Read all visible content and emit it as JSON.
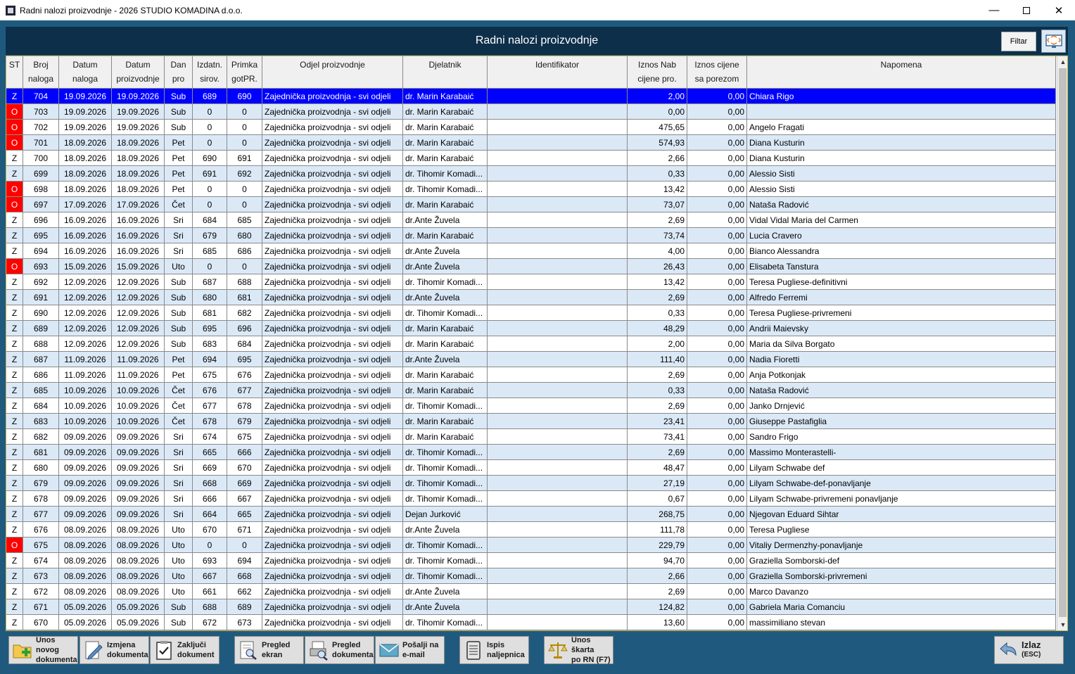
{
  "window": {
    "title": "Radni nalozi proizvodnje - 2026 STUDIO KOMADINA d.o.o.",
    "minimize": "—",
    "close": "✕"
  },
  "header": {
    "title": "Radni nalozi proizvodnje",
    "filter_label": "Filtar"
  },
  "columns": [
    {
      "key": "st",
      "label": "ST"
    },
    {
      "key": "broj",
      "label": "Broj\nnaloga"
    },
    {
      "key": "datum_naloga",
      "label": "Datum\nnaloga"
    },
    {
      "key": "datum_proizvodnje",
      "label": "Datum\nproizvodnje"
    },
    {
      "key": "dan",
      "label": "Dan\npro"
    },
    {
      "key": "izdatn",
      "label": "Izdatn.\nsirov."
    },
    {
      "key": "primka",
      "label": "Primka\ngotPR."
    },
    {
      "key": "odjel",
      "label": "Odjel proizvodnje"
    },
    {
      "key": "djelatnik",
      "label": "Djelatnik"
    },
    {
      "key": "identifikator",
      "label": "Identifikator"
    },
    {
      "key": "iznos_nab",
      "label": "Iznos Nab\ncijene pro."
    },
    {
      "key": "iznos_cijene",
      "label": "Iznos cijene\nsa porezom"
    },
    {
      "key": "napomena",
      "label": "Napomena"
    }
  ],
  "rows": [
    [
      "Z",
      "704",
      "19.09.2026",
      "19.09.2026",
      "Sub",
      "689",
      "690",
      "Zajednička proizvodnja - svi odjeli",
      "dr. Marin Karabaić",
      "",
      "2,00",
      "0,00",
      "Chiara Rigo"
    ],
    [
      "O",
      "703",
      "19.09.2026",
      "19.09.2026",
      "Sub",
      "0",
      "0",
      "Zajednička proizvodnja - svi odjeli",
      "dr. Marin Karabaić",
      "",
      "0,00",
      "0,00",
      ""
    ],
    [
      "O",
      "702",
      "19.09.2026",
      "19.09.2026",
      "Sub",
      "0",
      "0",
      "Zajednička proizvodnja - svi odjeli",
      "dr. Marin Karabaić",
      "",
      "475,65",
      "0,00",
      "Angelo Fragati"
    ],
    [
      "O",
      "701",
      "18.09.2026",
      "18.09.2026",
      "Pet",
      "0",
      "0",
      "Zajednička proizvodnja - svi odjeli",
      "dr. Marin Karabaić",
      "",
      "574,93",
      "0,00",
      "Diana Kusturin"
    ],
    [
      "Z",
      "700",
      "18.09.2026",
      "18.09.2026",
      "Pet",
      "690",
      "691",
      "Zajednička proizvodnja - svi odjeli",
      "dr. Marin Karabaić",
      "",
      "2,66",
      "0,00",
      "Diana Kusturin"
    ],
    [
      "Z",
      "699",
      "18.09.2026",
      "18.09.2026",
      "Pet",
      "691",
      "692",
      "Zajednička proizvodnja - svi odjeli",
      "dr. Tihomir Komadi...",
      "",
      "0,33",
      "0,00",
      "Alessio Sisti"
    ],
    [
      "O",
      "698",
      "18.09.2026",
      "18.09.2026",
      "Pet",
      "0",
      "0",
      "Zajednička proizvodnja - svi odjeli",
      "dr. Tihomir Komadi...",
      "",
      "13,42",
      "0,00",
      "Alessio Sisti"
    ],
    [
      "O",
      "697",
      "17.09.2026",
      "17.09.2026",
      "Čet",
      "0",
      "0",
      "Zajednička proizvodnja - svi odjeli",
      "dr. Marin Karabaić",
      "",
      "73,07",
      "0,00",
      "Nataša Radović"
    ],
    [
      "Z",
      "696",
      "16.09.2026",
      "16.09.2026",
      "Sri",
      "684",
      "685",
      "Zajednička proizvodnja - svi odjeli",
      "dr.Ante Žuvela",
      "",
      "2,69",
      "0,00",
      "Vidal Vidal Maria del Carmen"
    ],
    [
      "Z",
      "695",
      "16.09.2026",
      "16.09.2026",
      "Sri",
      "679",
      "680",
      "Zajednička proizvodnja - svi odjeli",
      "dr. Marin Karabaić",
      "",
      "73,74",
      "0,00",
      "Lucia Cravero"
    ],
    [
      "Z",
      "694",
      "16.09.2026",
      "16.09.2026",
      "Sri",
      "685",
      "686",
      "Zajednička proizvodnja - svi odjeli",
      "dr.Ante Žuvela",
      "",
      "4,00",
      "0,00",
      "Bianco Alessandra"
    ],
    [
      "O",
      "693",
      "15.09.2026",
      "15.09.2026",
      "Uto",
      "0",
      "0",
      "Zajednička proizvodnja - svi odjeli",
      "dr.Ante Žuvela",
      "",
      "26,43",
      "0,00",
      "Elisabeta Tanstura"
    ],
    [
      "Z",
      "692",
      "12.09.2026",
      "12.09.2026",
      "Sub",
      "687",
      "688",
      "Zajednička proizvodnja - svi odjeli",
      "dr. Tihomir Komadi...",
      "",
      "13,42",
      "0,00",
      "Teresa Pugliese-definitivni"
    ],
    [
      "Z",
      "691",
      "12.09.2026",
      "12.09.2026",
      "Sub",
      "680",
      "681",
      "Zajednička proizvodnja - svi odjeli",
      "dr.Ante Žuvela",
      "",
      "2,69",
      "0,00",
      "Alfredo Ferremi"
    ],
    [
      "Z",
      "690",
      "12.09.2026",
      "12.09.2026",
      "Sub",
      "681",
      "682",
      "Zajednička proizvodnja - svi odjeli",
      "dr. Tihomir Komadi...",
      "",
      "0,33",
      "0,00",
      "Teresa Pugliese-privremeni"
    ],
    [
      "Z",
      "689",
      "12.09.2026",
      "12.09.2026",
      "Sub",
      "695",
      "696",
      "Zajednička proizvodnja - svi odjeli",
      "dr. Marin Karabaić",
      "",
      "48,29",
      "0,00",
      "Andrii Maievsky"
    ],
    [
      "Z",
      "688",
      "12.09.2026",
      "12.09.2026",
      "Sub",
      "683",
      "684",
      "Zajednička proizvodnja - svi odjeli",
      "dr. Marin Karabaić",
      "",
      "2,00",
      "0,00",
      "Maria da Silva Borgato"
    ],
    [
      "Z",
      "687",
      "11.09.2026",
      "11.09.2026",
      "Pet",
      "694",
      "695",
      "Zajednička proizvodnja - svi odjeli",
      "dr.Ante Žuvela",
      "",
      "111,40",
      "0,00",
      "Nadia Fioretti"
    ],
    [
      "Z",
      "686",
      "11.09.2026",
      "11.09.2026",
      "Pet",
      "675",
      "676",
      "Zajednička proizvodnja - svi odjeli",
      "dr. Marin Karabaić",
      "",
      "2,69",
      "0,00",
      "Anja Potkonjak"
    ],
    [
      "Z",
      "685",
      "10.09.2026",
      "10.09.2026",
      "Čet",
      "676",
      "677",
      "Zajednička proizvodnja - svi odjeli",
      "dr. Marin Karabaić",
      "",
      "0,33",
      "0,00",
      "Nataša Radović"
    ],
    [
      "Z",
      "684",
      "10.09.2026",
      "10.09.2026",
      "Čet",
      "677",
      "678",
      "Zajednička proizvodnja - svi odjeli",
      "dr. Tihomir Komadi...",
      "",
      "2,69",
      "0,00",
      "Janko Drnjević"
    ],
    [
      "Z",
      "683",
      "10.09.2026",
      "10.09.2026",
      "Čet",
      "678",
      "679",
      "Zajednička proizvodnja - svi odjeli",
      "dr. Marin Karabaić",
      "",
      "23,41",
      "0,00",
      "Giuseppe Pastafiglia"
    ],
    [
      "Z",
      "682",
      "09.09.2026",
      "09.09.2026",
      "Sri",
      "674",
      "675",
      "Zajednička proizvodnja - svi odjeli",
      "dr. Marin Karabaić",
      "",
      "73,41",
      "0,00",
      "Sandro Frigo"
    ],
    [
      "Z",
      "681",
      "09.09.2026",
      "09.09.2026",
      "Sri",
      "665",
      "666",
      "Zajednička proizvodnja - svi odjeli",
      "dr. Tihomir Komadi...",
      "",
      "2,69",
      "0,00",
      "Massimo Monterastelli-"
    ],
    [
      "Z",
      "680",
      "09.09.2026",
      "09.09.2026",
      "Sri",
      "669",
      "670",
      "Zajednička proizvodnja - svi odjeli",
      "dr. Tihomir Komadi...",
      "",
      "48,47",
      "0,00",
      "Lilyam Schwabe def"
    ],
    [
      "Z",
      "679",
      "09.09.2026",
      "09.09.2026",
      "Sri",
      "668",
      "669",
      "Zajednička proizvodnja - svi odjeli",
      "dr. Tihomir Komadi...",
      "",
      "27,19",
      "0,00",
      "Lilyam Schwabe-def-ponavljanje"
    ],
    [
      "Z",
      "678",
      "09.09.2026",
      "09.09.2026",
      "Sri",
      "666",
      "667",
      "Zajednička proizvodnja - svi odjeli",
      "dr. Tihomir Komadi...",
      "",
      "0,67",
      "0,00",
      "Lilyam Schwabe-privremeni ponavljanje"
    ],
    [
      "Z",
      "677",
      "09.09.2026",
      "09.09.2026",
      "Sri",
      "664",
      "665",
      "Zajednička proizvodnja - svi odjeli",
      "Dejan Jurković",
      "",
      "268,75",
      "0,00",
      "Njegovan Eduard Sihtar"
    ],
    [
      "Z",
      "676",
      "08.09.2026",
      "08.09.2026",
      "Uto",
      "670",
      "671",
      "Zajednička proizvodnja - svi odjeli",
      "dr.Ante Žuvela",
      "",
      "111,78",
      "0,00",
      "Teresa Pugliese"
    ],
    [
      "O",
      "675",
      "08.09.2026",
      "08.09.2026",
      "Uto",
      "0",
      "0",
      "Zajednička proizvodnja - svi odjeli",
      "dr. Tihomir Komadi...",
      "",
      "229,79",
      "0,00",
      "Vitaliy Dermenzhy-ponavljanje"
    ],
    [
      "Z",
      "674",
      "08.09.2026",
      "08.09.2026",
      "Uto",
      "693",
      "694",
      "Zajednička proizvodnja - svi odjeli",
      "dr. Tihomir Komadi...",
      "",
      "94,70",
      "0,00",
      "Graziella Somborski-def"
    ],
    [
      "Z",
      "673",
      "08.09.2026",
      "08.09.2026",
      "Uto",
      "667",
      "668",
      "Zajednička proizvodnja - svi odjeli",
      "dr. Tihomir Komadi...",
      "",
      "2,66",
      "0,00",
      "Graziella Somborski-privremeni"
    ],
    [
      "Z",
      "672",
      "08.09.2026",
      "08.09.2026",
      "Uto",
      "661",
      "662",
      "Zajednička proizvodnja - svi odjeli",
      "dr.Ante Žuvela",
      "",
      "2,69",
      "0,00",
      "Marco Davanzo"
    ],
    [
      "Z",
      "671",
      "05.09.2026",
      "05.09.2026",
      "Sub",
      "688",
      "689",
      "Zajednička proizvodnja - svi odjeli",
      "dr.Ante Žuvela",
      "",
      "124,82",
      "0,00",
      "Gabriela Maria Comanciu"
    ],
    [
      "Z",
      "670",
      "05.09.2026",
      "05.09.2026",
      "Sub",
      "672",
      "673",
      "Zajednička proizvodnja - svi odjeli",
      "dr. Tihomir Komadi...",
      "",
      "13,60",
      "0,00",
      "massimiliano stevan"
    ]
  ],
  "selected_row": 0,
  "toolbar": {
    "new_doc": "Unos novog\ndokumenta",
    "edit_doc": "Izmjena\ndokumenta",
    "close_doc": "Zaključi\ndokument",
    "preview_screen": "Pregled\nekran",
    "preview_doc": "Pregled\ndokumenta",
    "send_email": "Pošalji na\ne-mail",
    "print_labels": "Ispis\nnaljepnica",
    "scrap_entry": "Unos škarta\npo RN (F7)",
    "exit": "Izlaz",
    "exit_sub": "(ESC)"
  },
  "icons": {
    "new_doc": "folder-plus-icon",
    "edit_doc": "edit-pencil-icon",
    "close_doc": "checklist-icon",
    "preview_screen": "magnifier-doc-icon",
    "preview_doc": "printer-preview-icon",
    "send_email": "envelope-icon",
    "print_labels": "label-print-icon",
    "scrap_entry": "scales-icon",
    "exit": "back-arrow-icon"
  },
  "colors": {
    "frame": "#1f5a7e",
    "header": "#0d2f4a",
    "selected": "#0000ff",
    "status_open": "#ff0000",
    "row_alt": "#dbe9f7"
  }
}
